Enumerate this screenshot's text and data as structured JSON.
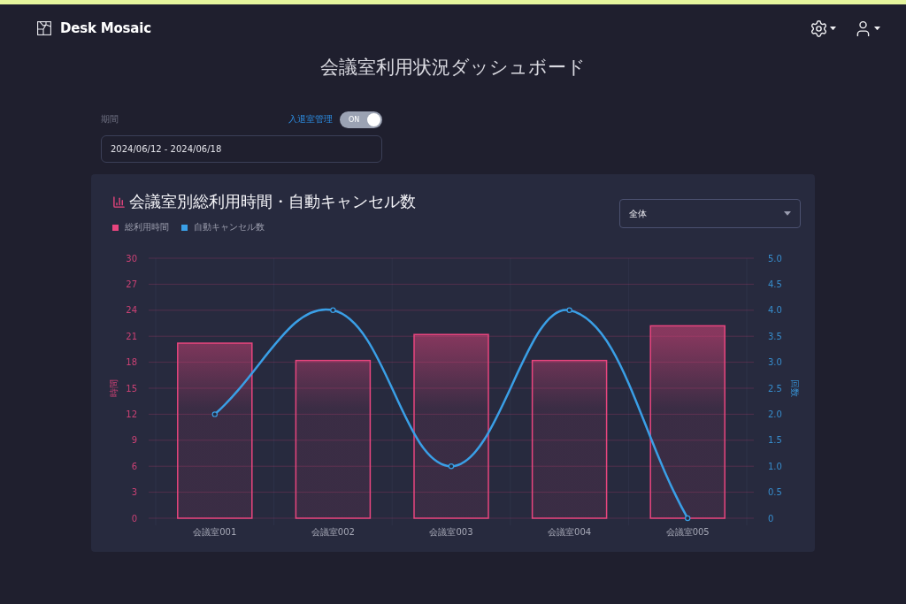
{
  "app": {
    "name": "Desk Mosaic"
  },
  "page_title": "会議室利用状況ダッシュボード",
  "filters": {
    "period_label": "期間",
    "period_value": "2024/06/12 - 2024/06/18",
    "toggle": {
      "label": "入退室管理",
      "state_text": "ON",
      "on": true
    }
  },
  "chart_card": {
    "title": "会議室別総利用時間・自動キャンセル数",
    "scope_select": {
      "value": "全体"
    },
    "chart_data": {
      "type": "bar",
      "categories": [
        "会議室001",
        "会議室002",
        "会議室003",
        "会議室004",
        "会議室005"
      ],
      "ylabel": "時間",
      "ylim": [
        0,
        30
      ],
      "yticks": [
        0,
        3,
        6,
        9,
        12,
        15,
        18,
        21,
        24,
        27,
        30
      ],
      "y2label": "回数",
      "y2lim": [
        0,
        5
      ],
      "y2ticks": [
        {
          "value": 0,
          "label": "0"
        },
        {
          "value": 0.5,
          "label": "0.5"
        },
        {
          "value": 1,
          "label": "1.0"
        },
        {
          "value": 1.5,
          "label": "1.5"
        },
        {
          "value": 2,
          "label": "2.0"
        },
        {
          "value": 2.5,
          "label": "2.5"
        },
        {
          "value": 3,
          "label": "3.0"
        },
        {
          "value": 3.5,
          "label": "3.5"
        },
        {
          "value": 4,
          "label": "4.0"
        },
        {
          "value": 4.5,
          "label": "4.5"
        },
        {
          "value": 5,
          "label": "5.0"
        }
      ],
      "grid": true,
      "series": [
        {
          "name": "総利用時間",
          "color": "#e8457e",
          "values": [
            20.2,
            18.2,
            21.2,
            18.2,
            22.2
          ]
        },
        {
          "name": "自動キャンセル数",
          "color": "#3a9fe6",
          "type": "line",
          "axis": "y2",
          "marker": "circle",
          "values": [
            2,
            4,
            1,
            4,
            0
          ]
        }
      ]
    }
  }
}
